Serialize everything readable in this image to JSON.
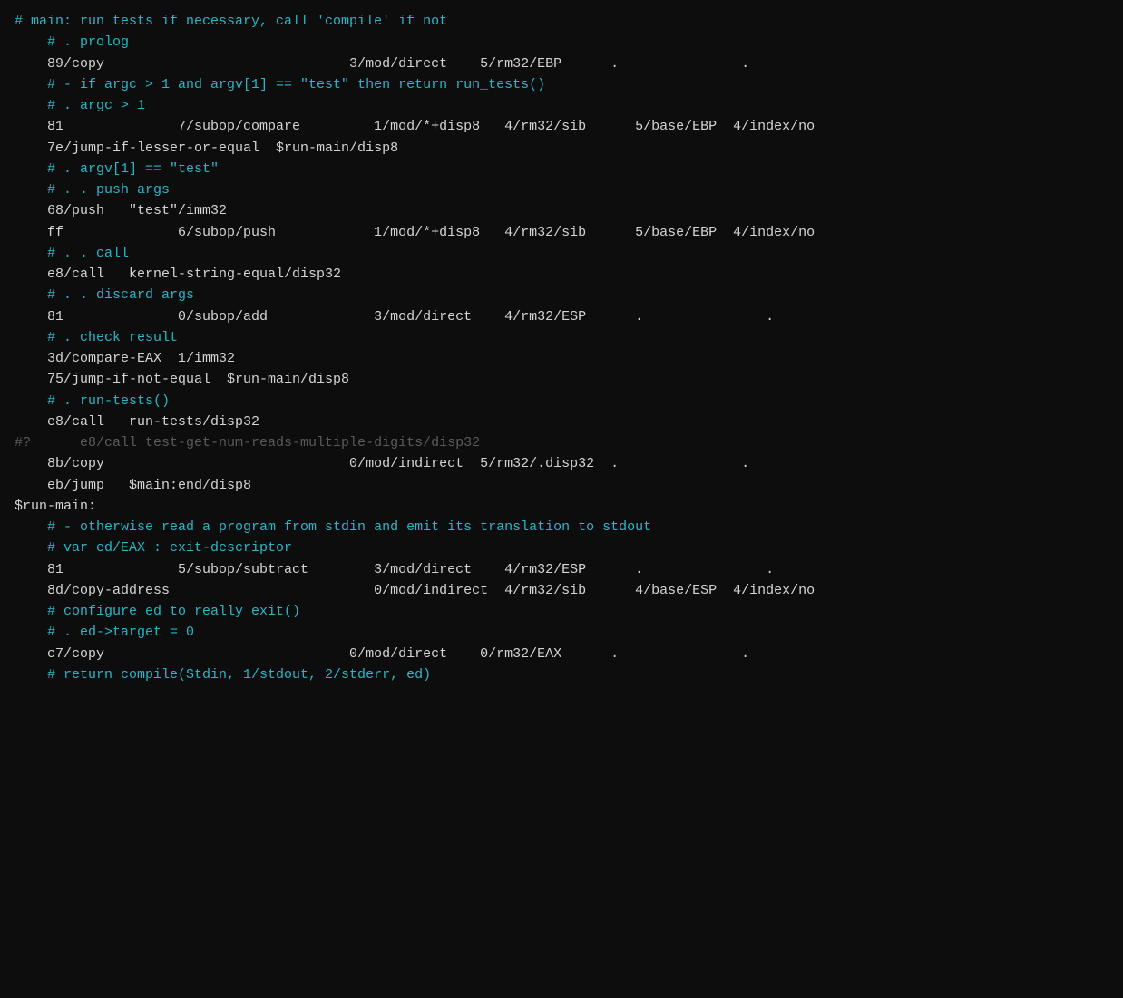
{
  "lines": [
    {
      "id": "l1",
      "parts": [
        {
          "text": "# main: run tests if necessary, call 'compile' if not",
          "color": "cyan"
        }
      ]
    },
    {
      "id": "l2",
      "parts": [
        {
          "text": "    # . prolog",
          "color": "cyan"
        }
      ]
    },
    {
      "id": "l3",
      "parts": [
        {
          "text": "    89/copy                              3/mod/direct    5/rm32/EBP      .               .",
          "color": "white"
        }
      ]
    },
    {
      "id": "l4",
      "parts": [
        {
          "text": "    # - if argc > 1 and argv[1] == \"test\" then return run_tests()",
          "color": "cyan"
        }
      ]
    },
    {
      "id": "l5",
      "parts": [
        {
          "text": "    # . argc > 1",
          "color": "cyan"
        }
      ]
    },
    {
      "id": "l6",
      "parts": [
        {
          "text": "    81              7/subop/compare         1/mod/*+disp8   4/rm32/sib      5/base/EBP  4/index/no",
          "color": "white"
        }
      ]
    },
    {
      "id": "l7",
      "parts": [
        {
          "text": "    7e/jump-if-lesser-or-equal  $run-main/disp8",
          "color": "white"
        }
      ]
    },
    {
      "id": "l8",
      "parts": [
        {
          "text": "    # . argv[1] == \"test\"",
          "color": "cyan"
        }
      ]
    },
    {
      "id": "l9",
      "parts": [
        {
          "text": "    # . . push args",
          "color": "cyan"
        }
      ]
    },
    {
      "id": "l10",
      "parts": [
        {
          "text": "    68/push   \"test\"/imm32",
          "color": "white"
        }
      ]
    },
    {
      "id": "l11",
      "parts": [
        {
          "text": "    ff              6/subop/push            1/mod/*+disp8   4/rm32/sib      5/base/EBP  4/index/no",
          "color": "white"
        }
      ]
    },
    {
      "id": "l12",
      "parts": [
        {
          "text": "    # . . call",
          "color": "cyan"
        }
      ]
    },
    {
      "id": "l13",
      "parts": [
        {
          "text": "    e8/call   kernel-string-equal/disp32",
          "color": "white"
        }
      ]
    },
    {
      "id": "l14",
      "parts": [
        {
          "text": "    # . . discard args",
          "color": "cyan"
        }
      ]
    },
    {
      "id": "l15",
      "parts": [
        {
          "text": "    81              0/subop/add             3/mod/direct    4/rm32/ESP      .               .",
          "color": "white"
        }
      ]
    },
    {
      "id": "l16",
      "parts": [
        {
          "text": "    # . check result",
          "color": "cyan"
        }
      ]
    },
    {
      "id": "l17",
      "parts": [
        {
          "text": "    3d/compare-EAX  1/imm32",
          "color": "white"
        }
      ]
    },
    {
      "id": "l18",
      "parts": [
        {
          "text": "    75/jump-if-not-equal  $run-main/disp8",
          "color": "white"
        }
      ]
    },
    {
      "id": "l19",
      "parts": [
        {
          "text": "    # . run-tests()",
          "color": "cyan"
        }
      ]
    },
    {
      "id": "l20",
      "parts": [
        {
          "text": "    e8/call   run-tests/disp32",
          "color": "white"
        }
      ]
    },
    {
      "id": "l21",
      "parts": [
        {
          "text": "#?      e8/call test-get-num-reads-multiple-digits/disp32",
          "color": "gray"
        }
      ]
    },
    {
      "id": "l22",
      "parts": [
        {
          "text": "    8b/copy                              0/mod/indirect  5/rm32/.disp32  .               .",
          "color": "white"
        }
      ]
    },
    {
      "id": "l23",
      "parts": [
        {
          "text": "    eb/jump   $main:end/disp8",
          "color": "white"
        }
      ]
    },
    {
      "id": "l24",
      "parts": [
        {
          "text": "$run-main:",
          "color": "white"
        }
      ]
    },
    {
      "id": "l25",
      "parts": [
        {
          "text": "    # - otherwise read a program from stdin and emit its translation to stdout",
          "color": "cyan"
        }
      ]
    },
    {
      "id": "l26",
      "parts": [
        {
          "text": "    # var ed/EAX : exit-descriptor",
          "color": "cyan"
        }
      ]
    },
    {
      "id": "l27",
      "parts": [
        {
          "text": "    81              5/subop/subtract        3/mod/direct    4/rm32/ESP      .               .",
          "color": "white"
        }
      ]
    },
    {
      "id": "l28",
      "parts": [
        {
          "text": "    8d/copy-address                         0/mod/indirect  4/rm32/sib      4/base/ESP  4/index/no",
          "color": "white"
        }
      ]
    },
    {
      "id": "l29",
      "parts": [
        {
          "text": "    # configure ed to really exit()",
          "color": "cyan"
        }
      ]
    },
    {
      "id": "l30",
      "parts": [
        {
          "text": "    # . ed->target = 0",
          "color": "cyan"
        }
      ]
    },
    {
      "id": "l31",
      "parts": [
        {
          "text": "    c7/copy                              0/mod/direct    0/rm32/EAX      .               .",
          "color": "white"
        }
      ]
    },
    {
      "id": "l32",
      "parts": [
        {
          "text": "    # return compile(Stdin, 1/stdout, 2/stderr, ed)",
          "color": "cyan"
        }
      ]
    }
  ]
}
